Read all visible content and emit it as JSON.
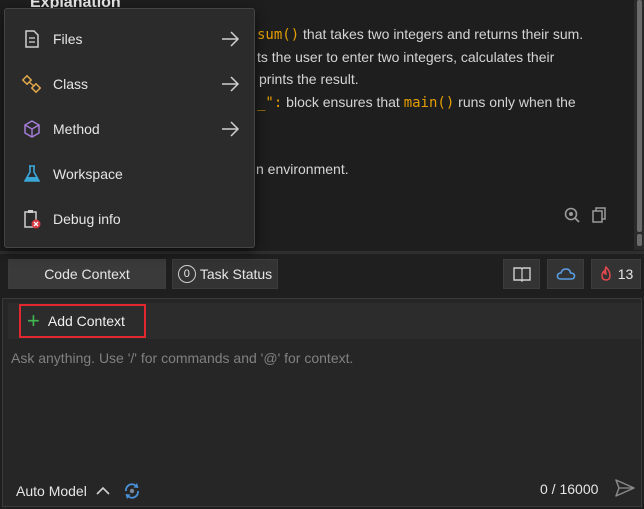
{
  "content": {
    "heading": "Explanation",
    "lines": [
      {
        "pre": "",
        "code": "sum()",
        "post": " that takes two integers and returns their sum."
      },
      {
        "pre": "ts the user to enter two integers, calculates their",
        "code": "",
        "post": ""
      },
      {
        "pre": "prints the result.",
        "code": "",
        "post": ""
      },
      {
        "pre": "",
        "code": "_\":",
        "post": " block ensures that "
      },
      {
        "pre": "",
        "code": "main()",
        "post": " runs only when the"
      },
      {
        "pre": "n environment.",
        "code": "",
        "post": ""
      }
    ]
  },
  "menu": {
    "items": [
      {
        "label": "Files",
        "icon": "files-icon",
        "has_submenu": true
      },
      {
        "label": "Class",
        "icon": "class-icon",
        "has_submenu": true
      },
      {
        "label": "Method",
        "icon": "method-icon",
        "has_submenu": true
      },
      {
        "label": "Workspace",
        "icon": "workspace-icon",
        "has_submenu": false
      },
      {
        "label": "Debug info",
        "icon": "debug-info-icon",
        "has_submenu": false
      }
    ]
  },
  "toolbar": {
    "code_context_label": "Code Context",
    "task_status_count": "0",
    "task_status_label": "Task Status",
    "issues_count": "13"
  },
  "input": {
    "add_context_label": "Add Context",
    "placeholder": "Ask anything. Use '/' for commands and '@' for context.",
    "value": "",
    "model_label": "Auto Model",
    "char_counter": "0 / 16000"
  },
  "colors": {
    "code_accent": "#e5a000",
    "highlight_border": "#e0282e",
    "add_plus": "#3fb950",
    "issues_flame": "#e5484d"
  }
}
